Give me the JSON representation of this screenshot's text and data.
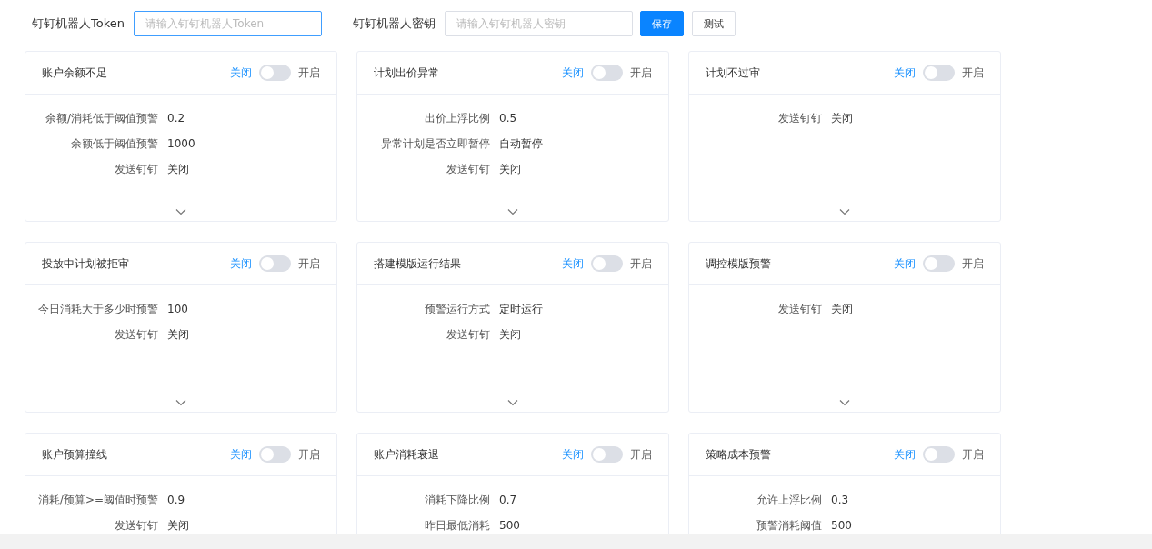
{
  "config": {
    "token_label": "钉钉机器人Token",
    "token_placeholder": "请输入钉钉机器人Token",
    "secret_label": "钉钉机器人密钥",
    "secret_placeholder": "请输入钉钉机器人密钥",
    "save_button": "保存",
    "test_button": "测试"
  },
  "cards": [
    {
      "title": "账户余额不足",
      "off_label": "关闭",
      "on_label": "开启",
      "on": false,
      "fields": [
        {
          "label": "余额/消耗低于阈值预警",
          "value": "0.2"
        },
        {
          "label": "余额低于阈值预警",
          "value": "1000"
        },
        {
          "label": "发送钉钉",
          "value": "关闭"
        }
      ]
    },
    {
      "title": "计划出价异常",
      "off_label": "关闭",
      "on_label": "开启",
      "on": false,
      "fields": [
        {
          "label": "出价上浮比例",
          "value": "0.5"
        },
        {
          "label": "异常计划是否立即暂停",
          "value": "自动暂停"
        },
        {
          "label": "发送钉钉",
          "value": "关闭"
        }
      ]
    },
    {
      "title": "计划不过审",
      "off_label": "关闭",
      "on_label": "开启",
      "on": false,
      "fields": [
        {
          "label": "发送钉钉",
          "value": "关闭"
        }
      ]
    },
    {
      "title": "投放中计划被拒审",
      "off_label": "关闭",
      "on_label": "开启",
      "on": false,
      "fields": [
        {
          "label": "今日消耗大于多少时预警",
          "value": "100"
        },
        {
          "label": "发送钉钉",
          "value": "关闭"
        }
      ]
    },
    {
      "title": "搭建模版运行结果",
      "off_label": "关闭",
      "on_label": "开启",
      "on": false,
      "fields": [
        {
          "label": "预警运行方式",
          "value": "定时运行"
        },
        {
          "label": "发送钉钉",
          "value": "关闭"
        }
      ]
    },
    {
      "title": "调控模版预警",
      "off_label": "关闭",
      "on_label": "开启",
      "on": false,
      "fields": [
        {
          "label": "发送钉钉",
          "value": "关闭"
        }
      ]
    },
    {
      "title": "账户预算撞线",
      "off_label": "关闭",
      "on_label": "开启",
      "on": false,
      "fields": [
        {
          "label": "消耗/预算>=阈值时预警",
          "value": "0.9"
        },
        {
          "label": "发送钉钉",
          "value": "关闭"
        }
      ]
    },
    {
      "title": "账户消耗衰退",
      "off_label": "关闭",
      "on_label": "开启",
      "on": false,
      "fields": [
        {
          "label": "消耗下降比例",
          "value": "0.7"
        },
        {
          "label": "昨日最低消耗",
          "value": "500"
        }
      ]
    },
    {
      "title": "策略成本预警",
      "off_label": "关闭",
      "on_label": "开启",
      "on": false,
      "fields": [
        {
          "label": "允许上浮比例",
          "value": "0.3"
        },
        {
          "label": "预警消耗阈值",
          "value": "500"
        }
      ]
    }
  ]
}
